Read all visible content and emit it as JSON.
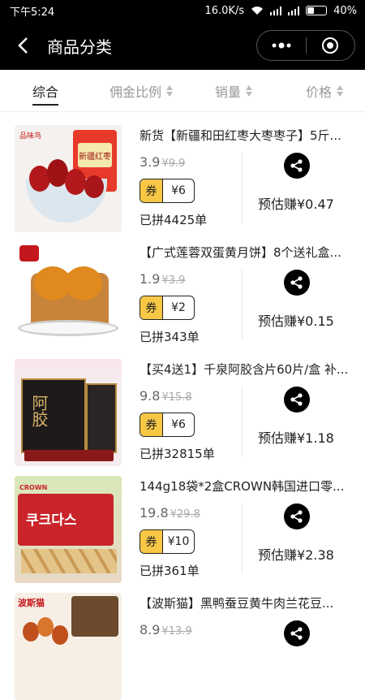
{
  "status": {
    "time": "下午5:24",
    "speed": "16.0K/s",
    "battery": "40%",
    "battery_level": 0.4
  },
  "header": {
    "title": "商品分类"
  },
  "tabs": [
    {
      "label": "综合",
      "active": true
    },
    {
      "label": "佣金比例",
      "active": false
    },
    {
      "label": "销量",
      "active": false
    },
    {
      "label": "价格",
      "active": false
    }
  ],
  "coupon_tag": "券",
  "items": [
    {
      "name": "新货【新疆和田红枣大枣枣子】5斤...",
      "price": "3.9",
      "orig": "¥9.9",
      "coupon": "¥6",
      "sold": "已拼4425单",
      "earn": "预估赚¥0.47"
    },
    {
      "name": "【广式莲蓉双蛋黄月饼】8个送礼盒...",
      "price": "1.9",
      "orig": "¥3.9",
      "coupon": "¥2",
      "sold": "已拼343单",
      "earn": "预估赚¥0.15"
    },
    {
      "name": "【买4送1】千泉阿胶含片60片/盒 补...",
      "price": "9.8",
      "orig": "¥15.8",
      "coupon": "¥6",
      "sold": "已拼32815单",
      "earn": "预估赚¥1.18"
    },
    {
      "name": "144g18袋*2盒CROWN韩国进口零...",
      "price": "19.8",
      "orig": "¥29.8",
      "coupon": "¥10",
      "sold": "已拼361单",
      "earn": "预估赚¥2.38"
    },
    {
      "name": "【波斯猫】黑鸭蚕豆黄牛肉兰花豆...",
      "price": "8.9",
      "orig": "¥13.9",
      "coupon": "",
      "sold": "",
      "earn": ""
    }
  ],
  "thumbs": [
    {
      "label": "新疆红枣",
      "brand": "品味鸟",
      "bg": "#f4f1ee",
      "accent": "#b3181b"
    },
    {
      "label": "",
      "brand": "",
      "bg": "#ffffff",
      "accent": "#e08a1e"
    },
    {
      "label": "阿胶",
      "brand": "",
      "bg": "#f4ecef",
      "accent": "#1e1a1a"
    },
    {
      "label": "쿠크다스",
      "brand": "CROWN",
      "bg": "#e8d9c6",
      "accent": "#c8242a"
    },
    {
      "label": "",
      "brand": "波斯猫",
      "bg": "#f7efe6",
      "accent": "#c0501e"
    }
  ]
}
